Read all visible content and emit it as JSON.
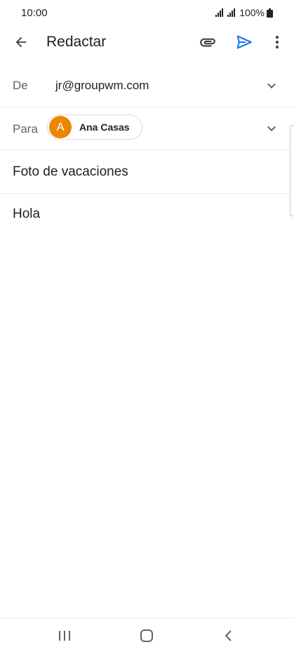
{
  "status_bar": {
    "time": "10:00",
    "battery_percent": "100%"
  },
  "app_bar": {
    "title": "Redactar",
    "icons": [
      "arrow-back-icon",
      "paperclip-icon",
      "send-icon",
      "more-vert-icon"
    ]
  },
  "compose": {
    "from_label": "De",
    "from_value": "jr@groupwm.com",
    "to_label": "Para",
    "recipient": {
      "initial": "A",
      "name": "Ana Casas"
    },
    "subject": "Foto de vacaciones",
    "body": "Hola"
  },
  "nav_bar": {
    "icons": [
      "recent-apps-icon",
      "home-icon",
      "back-icon"
    ]
  },
  "colors": {
    "accent": "#1a73e8",
    "avatar": "#ea8600",
    "text": "#202124",
    "label": "#5f6368"
  }
}
